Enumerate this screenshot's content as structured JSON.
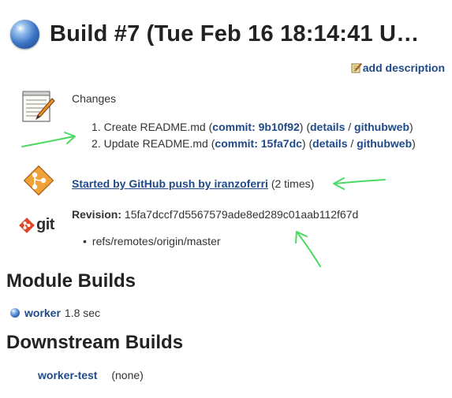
{
  "build": {
    "title": "Build #7 (Tue Feb 16 18:14:41 U…",
    "add_description": "add description"
  },
  "changes": {
    "label": "Changes",
    "items": [
      {
        "num": "1.",
        "text": "Create README.md",
        "commit_label": "commit: 9b10f92",
        "details": "details",
        "githubweb": "githubweb"
      },
      {
        "num": "2.",
        "text": "Update README.md",
        "commit_label": "commit: 15fa7dc",
        "details": "details",
        "githubweb": "githubweb"
      }
    ]
  },
  "cause": {
    "link": "Started by GitHub push by iranzoferri",
    "count": "(2 times)"
  },
  "revision": {
    "icon_text": "git",
    "label": "Revision:",
    "hash": "15fa7dccf7d5567579ade8ed289c01aab112f67d",
    "refs": [
      "refs/remotes/origin/master"
    ]
  },
  "module_builds": {
    "heading": "Module Builds",
    "items": [
      {
        "name": "worker",
        "duration": "1.8 sec"
      }
    ]
  },
  "downstream_builds": {
    "heading": "Downstream Builds",
    "items": [
      {
        "name": "worker-test",
        "status": "(none)"
      }
    ]
  },
  "colors": {
    "link": "#204a87",
    "text": "#333333",
    "annotation_arrow": "#4cd964",
    "status_ball": "#3a73c4"
  },
  "icons": [
    "blue-ball-icon",
    "notepad-pencil-icon",
    "github-push-icon",
    "git-logo-icon",
    "pencil-icon"
  ]
}
